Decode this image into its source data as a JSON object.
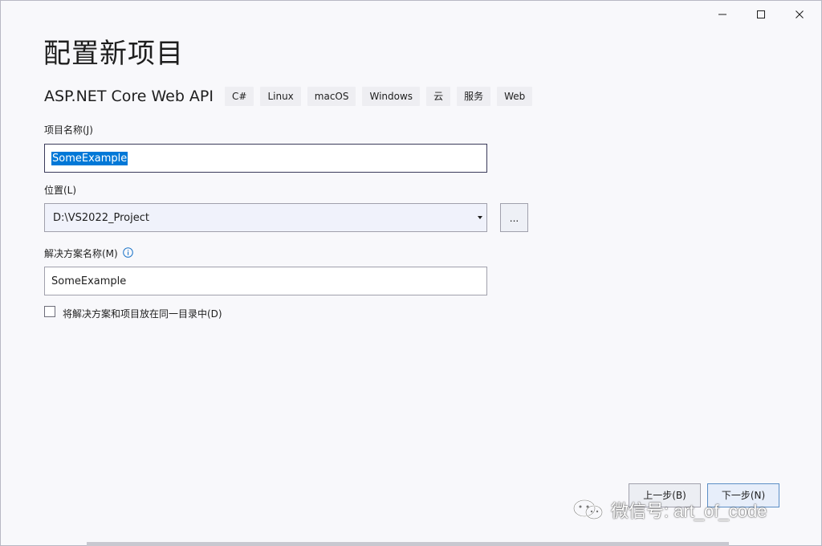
{
  "window": {
    "controls": {
      "minimize": "minimize",
      "maximize": "maximize",
      "close": "close"
    }
  },
  "page_title": "配置新项目",
  "template": {
    "name": "ASP.NET Core Web API",
    "tags": [
      "C#",
      "Linux",
      "macOS",
      "Windows",
      "云",
      "服务",
      "Web"
    ]
  },
  "project_name": {
    "label": "项目名称(J)",
    "value": "SomeExample"
  },
  "location": {
    "label": "位置(L)",
    "value": "D:\\VS2022_Project",
    "browse_label": "..."
  },
  "solution_name": {
    "label": "解决方案名称(M)",
    "value": "SomeExample"
  },
  "same_directory": {
    "label": "将解决方案和项目放在同一目录中(D)",
    "checked": false
  },
  "footer": {
    "back_label": "上一步(B)",
    "next_label": "下一步(N)"
  },
  "watermark": {
    "text": "微信号: art_of_code"
  },
  "colors": {
    "selection": "#0078d7",
    "info_icon": "#1a73c8",
    "primary_border": "#5b8ec6"
  }
}
